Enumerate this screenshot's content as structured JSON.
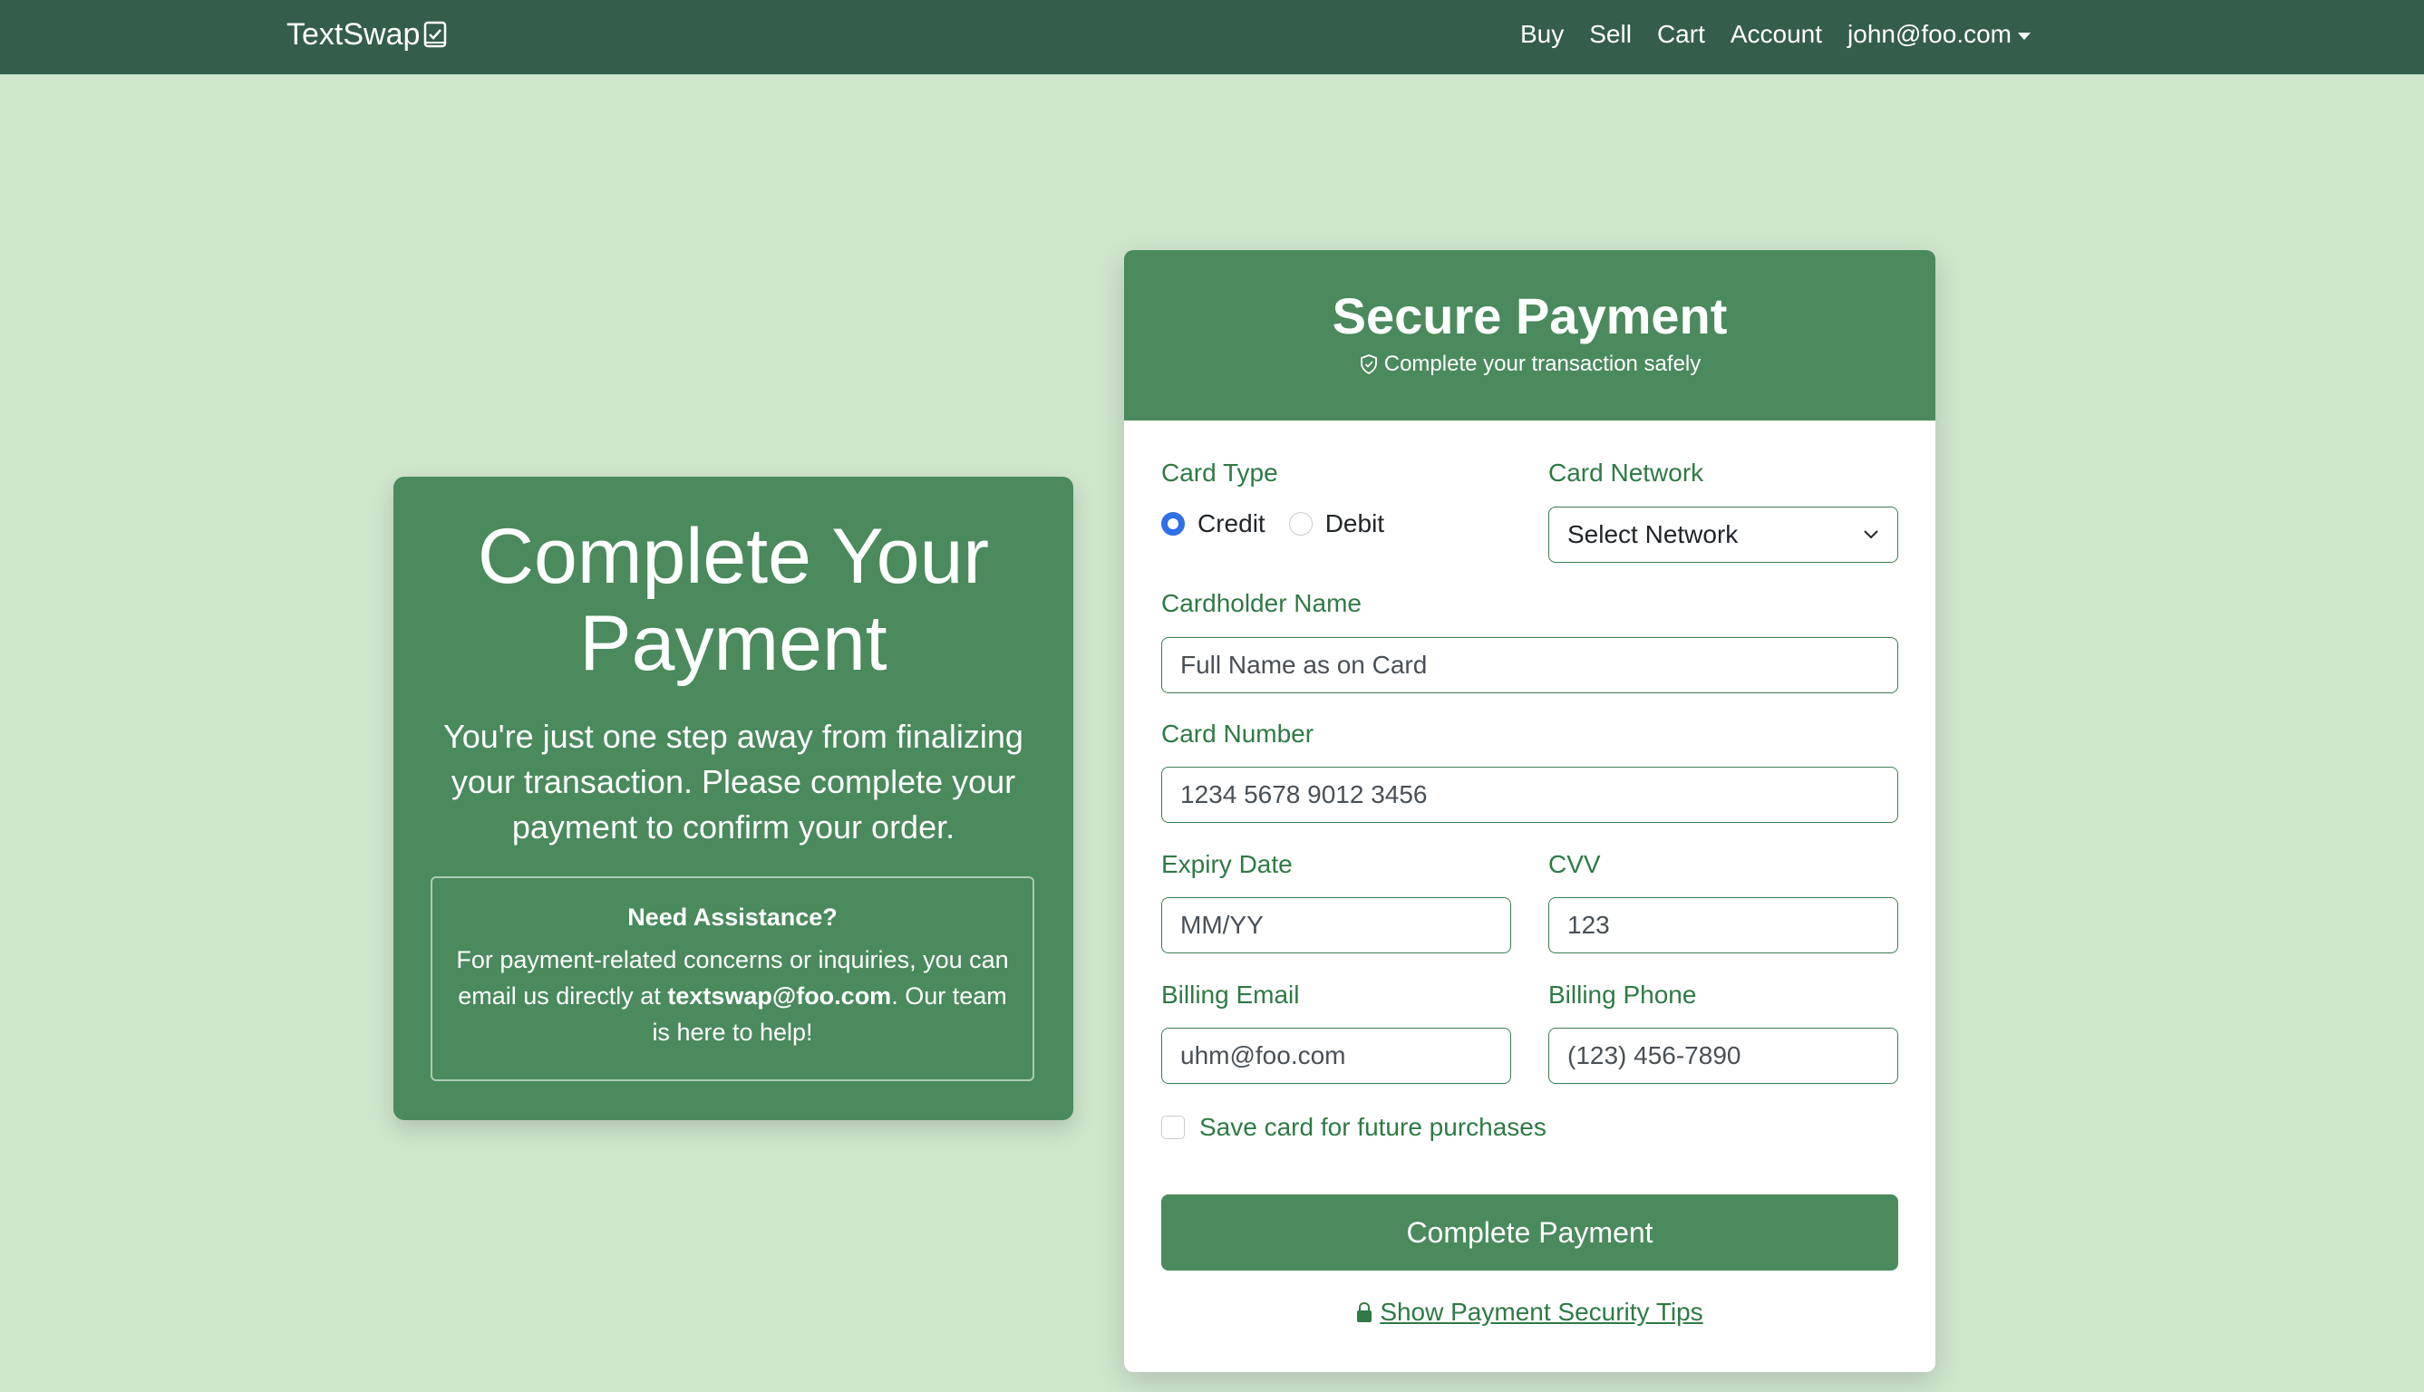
{
  "navbar": {
    "brand": "TextSwap",
    "links": [
      "Buy",
      "Sell",
      "Cart",
      "Account"
    ],
    "user": "john@foo.com"
  },
  "info": {
    "title": "Complete Your Payment",
    "text": "You're just one step away from finalizing your transaction. Please complete your payment to confirm your order.",
    "assist_title": "Need Assistance?",
    "assist_text_1": "For payment-related concerns or inquiries, you can email us directly at ",
    "assist_email": "textswap@foo.com",
    "assist_text_2": ". Our team is here to help!"
  },
  "payment": {
    "title": "Secure Payment",
    "subtitle": "Complete your transaction safely",
    "card_type_label": "Card Type",
    "credit_label": "Credit",
    "debit_label": "Debit",
    "selected_card_type": "Credit",
    "network_label": "Card Network",
    "network_value": "Select Network",
    "name_label": "Cardholder Name",
    "name_placeholder": "Full Name as on Card",
    "number_label": "Card Number",
    "number_placeholder": "1234 5678 9012 3456",
    "expiry_label": "Expiry Date",
    "expiry_placeholder": "MM/YY",
    "cvv_label": "CVV",
    "cvv_placeholder": "123",
    "email_label": "Billing Email",
    "email_placeholder": "uhm@foo.com",
    "phone_label": "Billing Phone",
    "phone_placeholder": "(123) 456-7890",
    "save_card_label": "Save card for future purchases",
    "submit_label": "Complete Payment",
    "tips_label": "Show Payment Security Tips"
  },
  "colors": {
    "navbar": "#345e4a",
    "accent": "#4a8a5c",
    "background": "#cfe5cc",
    "label": "#2f7a45",
    "radio_selected": "#2f6fe8"
  }
}
